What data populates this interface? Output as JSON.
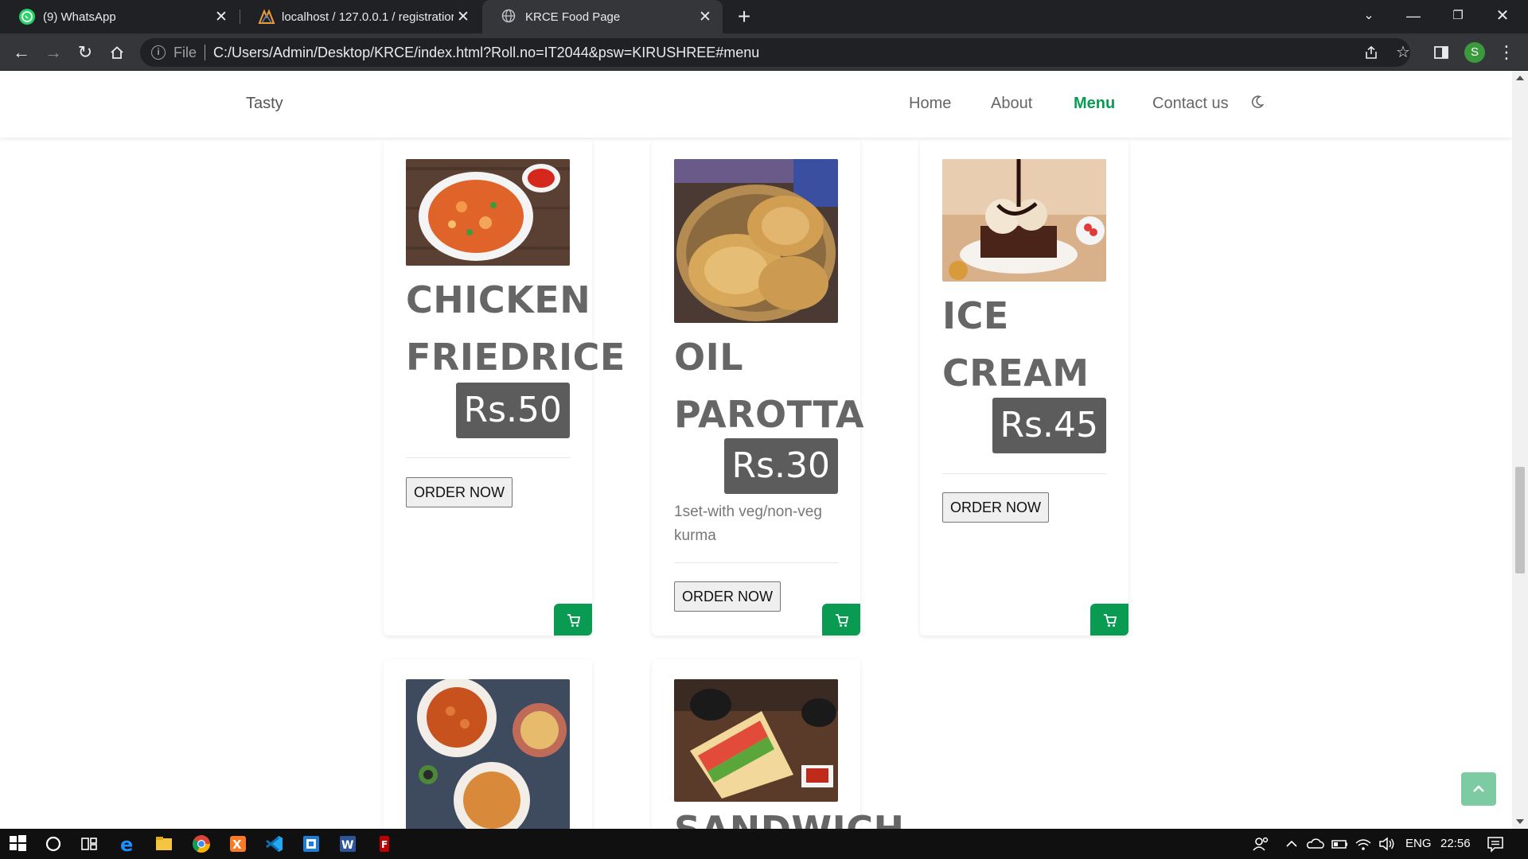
{
  "browser": {
    "tabs": [
      {
        "title": "(9) WhatsApp",
        "icon": "whatsapp-icon",
        "active": false
      },
      {
        "title": "localhost / 127.0.0.1 / registratior",
        "icon": "phpmyadmin-icon",
        "active": false
      },
      {
        "title": "KRCE Food Page",
        "icon": "globe-icon",
        "active": true
      }
    ],
    "address": {
      "scheme_label": "File",
      "url": "C:/Users/Admin/Desktop/KRCE/index.html?Roll.no=IT2044&psw=KIRUSHREE#menu"
    },
    "profile_initial": "S"
  },
  "site": {
    "brand": "Tasty",
    "nav": [
      {
        "label": "Home",
        "active": false
      },
      {
        "label": "About",
        "active": false
      },
      {
        "label": "Menu",
        "active": true
      },
      {
        "label": "Contact us",
        "active": false
      }
    ],
    "theme_toggle_icon": "moon-icon",
    "accent_color": "#0a9b52"
  },
  "menu": {
    "items": [
      {
        "name_line1": "CHICKEN",
        "name_line2": "FRIEDRICE",
        "price": "Rs.50",
        "description": "",
        "button": "ORDER NOW"
      },
      {
        "name_line1": "OIL",
        "name_line2": "PAROTTA",
        "price": "Rs.30",
        "description": "1set-with veg/non-veg kurma",
        "button": "ORDER NOW"
      },
      {
        "name_line1": "ICE",
        "name_line2": "CREAM",
        "price": "Rs.45",
        "description": "",
        "button": "ORDER NOW"
      },
      {
        "name_line1": "",
        "name_line2": "",
        "price": "",
        "description": "",
        "button": ""
      },
      {
        "name_line1": "SANDWICH",
        "name_line2": "",
        "price": "",
        "description": "",
        "button": ""
      }
    ]
  },
  "taskbar": {
    "language": "ENG",
    "time": "22:56"
  }
}
